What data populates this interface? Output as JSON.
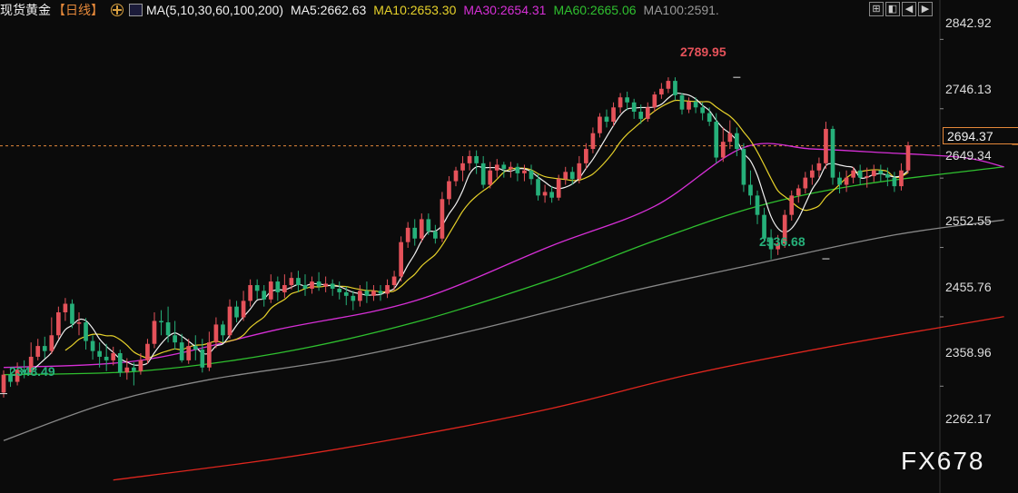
{
  "header": {
    "instrument": "现货黄金",
    "period": "【日线】",
    "study": "MA(5,10,30,60,100,200)",
    "ma5": "MA5:2662.63",
    "ma10": "MA10:2653.30",
    "ma30": "MA30:2654.31",
    "ma60": "MA60:2665.06",
    "ma100": "MA100:2591."
  },
  "toolbar": {
    "icons": [
      "fullscreen-icon",
      "layout-icon",
      "prev-icon",
      "next-icon"
    ]
  },
  "colors": {
    "up": "#e5525a",
    "down": "#26b07a",
    "ma5": "#f0f0f0",
    "ma10": "#e6d12a",
    "ma30": "#d62fd6",
    "ma60": "#2fc02f",
    "ma100": "#888888",
    "ma200": "#e0261e",
    "accent": "#e4883a"
  },
  "watermark": "FX678",
  "chart_data": {
    "type": "candlestick",
    "ylim": [
      2220,
      2870
    ],
    "y_ticks": [
      "2842.92",
      "2746.13",
      "2649.34",
      "2552.55",
      "2455.76",
      "2358.96",
      "2262.17"
    ],
    "y_tick_values": [
      2842.92,
      2746.13,
      2649.34,
      2552.55,
      2455.76,
      2358.96,
      2262.17
    ],
    "last_price": {
      "value": 2694.37,
      "label": "2694.37"
    },
    "annotations": [
      {
        "label": "2789.95",
        "value": 2789.95,
        "index": 107,
        "color": "#e5525a"
      },
      {
        "label": "2536.68",
        "value": 2536.68,
        "index": 120,
        "color": "#26b07a"
      },
      {
        "label": "2348.49",
        "value": 2348.49,
        "index": 0,
        "color": "#26b07a"
      }
    ],
    "candles": [
      [
        2350,
        2375,
        2343,
        2381
      ],
      [
        2375,
        2365,
        2358,
        2385
      ],
      [
        2365,
        2382,
        2360,
        2392
      ],
      [
        2382,
        2378,
        2370,
        2395
      ],
      [
        2378,
        2400,
        2375,
        2420
      ],
      [
        2400,
        2415,
        2395,
        2425
      ],
      [
        2415,
        2408,
        2398,
        2428
      ],
      [
        2408,
        2430,
        2404,
        2455
      ],
      [
        2430,
        2462,
        2425,
        2470
      ],
      [
        2462,
        2474,
        2450,
        2482
      ],
      [
        2474,
        2446,
        2440,
        2480
      ],
      [
        2446,
        2448,
        2430,
        2462
      ],
      [
        2448,
        2422,
        2410,
        2454
      ],
      [
        2422,
        2408,
        2396,
        2430
      ],
      [
        2408,
        2400,
        2385,
        2420
      ],
      [
        2400,
        2395,
        2380,
        2418
      ],
      [
        2395,
        2405,
        2388,
        2414
      ],
      [
        2405,
        2378,
        2372,
        2410
      ],
      [
        2378,
        2385,
        2368,
        2398
      ],
      [
        2385,
        2380,
        2360,
        2392
      ],
      [
        2380,
        2395,
        2375,
        2405
      ],
      [
        2395,
        2418,
        2390,
        2425
      ],
      [
        2418,
        2450,
        2412,
        2462
      ],
      [
        2450,
        2448,
        2430,
        2465
      ],
      [
        2448,
        2430,
        2420,
        2470
      ],
      [
        2430,
        2420,
        2410,
        2450
      ],
      [
        2420,
        2395,
        2392,
        2432
      ],
      [
        2395,
        2415,
        2390,
        2425
      ],
      [
        2415,
        2410,
        2395,
        2430
      ],
      [
        2410,
        2385,
        2378,
        2425
      ],
      [
        2385,
        2420,
        2380,
        2435
      ],
      [
        2420,
        2445,
        2412,
        2455
      ],
      [
        2445,
        2430,
        2420,
        2450
      ],
      [
        2430,
        2470,
        2425,
        2480
      ],
      [
        2470,
        2455,
        2448,
        2478
      ],
      [
        2455,
        2478,
        2450,
        2492
      ],
      [
        2478,
        2500,
        2470,
        2508
      ],
      [
        2500,
        2492,
        2480,
        2508
      ],
      [
        2492,
        2480,
        2470,
        2500
      ],
      [
        2480,
        2505,
        2475,
        2515
      ],
      [
        2505,
        2490,
        2478,
        2512
      ],
      [
        2490,
        2500,
        2482,
        2515
      ],
      [
        2500,
        2510,
        2494,
        2518
      ],
      [
        2510,
        2500,
        2490,
        2520
      ],
      [
        2500,
        2495,
        2485,
        2515
      ],
      [
        2495,
        2505,
        2488,
        2512
      ],
      [
        2505,
        2498,
        2492,
        2518
      ],
      [
        2498,
        2502,
        2490,
        2512
      ],
      [
        2502,
        2495,
        2485,
        2508
      ],
      [
        2495,
        2490,
        2480,
        2505
      ],
      [
        2490,
        2485,
        2472,
        2498
      ],
      [
        2485,
        2478,
        2465,
        2492
      ],
      [
        2478,
        2492,
        2470,
        2500
      ],
      [
        2492,
        2485,
        2475,
        2505
      ],
      [
        2485,
        2492,
        2478,
        2500
      ],
      [
        2492,
        2488,
        2478,
        2500
      ],
      [
        2488,
        2500,
        2482,
        2508
      ],
      [
        2500,
        2512,
        2492,
        2520
      ],
      [
        2512,
        2560,
        2505,
        2568
      ],
      [
        2560,
        2580,
        2552,
        2588
      ],
      [
        2580,
        2565,
        2555,
        2592
      ],
      [
        2565,
        2592,
        2560,
        2600
      ],
      [
        2592,
        2575,
        2570,
        2600
      ],
      [
        2575,
        2565,
        2558,
        2584
      ],
      [
        2565,
        2620,
        2560,
        2630
      ],
      [
        2620,
        2645,
        2612,
        2652
      ],
      [
        2645,
        2660,
        2638,
        2665
      ],
      [
        2660,
        2670,
        2645,
        2680
      ],
      [
        2670,
        2680,
        2660,
        2688
      ],
      [
        2680,
        2670,
        2655,
        2688
      ],
      [
        2670,
        2640,
        2635,
        2680
      ],
      [
        2640,
        2660,
        2635,
        2672
      ],
      [
        2660,
        2668,
        2650,
        2676
      ],
      [
        2668,
        2662,
        2650,
        2672
      ],
      [
        2662,
        2665,
        2650,
        2672
      ],
      [
        2665,
        2656,
        2645,
        2670
      ],
      [
        2656,
        2660,
        2645,
        2668
      ],
      [
        2660,
        2648,
        2640,
        2668
      ],
      [
        2648,
        2625,
        2618,
        2655
      ],
      [
        2625,
        2630,
        2615,
        2640
      ],
      [
        2630,
        2622,
        2615,
        2638
      ],
      [
        2622,
        2648,
        2618,
        2654
      ],
      [
        2648,
        2658,
        2640,
        2665
      ],
      [
        2658,
        2648,
        2640,
        2665
      ],
      [
        2648,
        2670,
        2642,
        2680
      ],
      [
        2670,
        2690,
        2662,
        2698
      ],
      [
        2690,
        2712,
        2684,
        2720
      ],
      [
        2712,
        2735,
        2706,
        2740
      ],
      [
        2735,
        2728,
        2720,
        2745
      ],
      [
        2728,
        2748,
        2722,
        2755
      ],
      [
        2748,
        2762,
        2740,
        2768
      ],
      [
        2762,
        2755,
        2744,
        2770
      ],
      [
        2755,
        2742,
        2732,
        2760
      ],
      [
        2742,
        2732,
        2725,
        2752
      ],
      [
        2732,
        2748,
        2728,
        2755
      ],
      [
        2748,
        2766,
        2742,
        2770
      ],
      [
        2766,
        2774,
        2760,
        2782
      ],
      [
        2774,
        2785,
        2768,
        2790
      ],
      [
        2785,
        2765,
        2758,
        2790
      ],
      [
        2765,
        2745,
        2738,
        2768
      ],
      [
        2745,
        2756,
        2740,
        2762
      ],
      [
        2756,
        2748,
        2740,
        2762
      ],
      [
        2748,
        2740,
        2730,
        2755
      ],
      [
        2740,
        2728,
        2722,
        2748
      ],
      [
        2728,
        2678,
        2670,
        2740
      ],
      [
        2678,
        2700,
        2672,
        2720
      ],
      [
        2700,
        2712,
        2690,
        2730
      ],
      [
        2712,
        2690,
        2680,
        2720
      ],
      [
        2690,
        2640,
        2630,
        2698
      ],
      [
        2640,
        2625,
        2612,
        2660
      ],
      [
        2625,
        2598,
        2585,
        2632
      ],
      [
        2598,
        2565,
        2560,
        2608
      ],
      [
        2565,
        2550,
        2536,
        2578
      ],
      [
        2550,
        2558,
        2542,
        2570
      ],
      [
        2558,
        2598,
        2552,
        2605
      ],
      [
        2598,
        2625,
        2590,
        2632
      ],
      [
        2625,
        2635,
        2615,
        2640
      ],
      [
        2635,
        2650,
        2628,
        2658
      ],
      [
        2650,
        2660,
        2640,
        2668
      ],
      [
        2660,
        2670,
        2650,
        2678
      ],
      [
        2670,
        2718,
        2662,
        2728
      ],
      [
        2718,
        2650,
        2640,
        2722
      ],
      [
        2650,
        2640,
        2628,
        2658
      ],
      [
        2640,
        2650,
        2630,
        2660
      ],
      [
        2650,
        2660,
        2642,
        2665
      ],
      [
        2660,
        2650,
        2640,
        2668
      ],
      [
        2650,
        2652,
        2636,
        2664
      ],
      [
        2652,
        2660,
        2644,
        2668
      ],
      [
        2660,
        2655,
        2645,
        2668
      ],
      [
        2655,
        2650,
        2638,
        2664
      ],
      [
        2650,
        2638,
        2630,
        2658
      ],
      [
        2638,
        2660,
        2632,
        2670
      ],
      [
        2660,
        2695,
        2656,
        2700
      ]
    ],
    "ma": {
      "ma30": {
        "name": "MA30",
        "color": "#d62fd6",
        "points": [
          [
            0,
            2385
          ],
          [
            20,
            2395
          ],
          [
            40,
            2438
          ],
          [
            60,
            2478
          ],
          [
            80,
            2555
          ],
          [
            95,
            2610
          ],
          [
            108,
            2692
          ],
          [
            118,
            2690
          ],
          [
            128,
            2685
          ],
          [
            140,
            2678
          ],
          [
            146,
            2665
          ]
        ]
      },
      "ma60": {
        "name": "MA60",
        "color": "#2fc02f",
        "points": [
          [
            0,
            2375
          ],
          [
            20,
            2380
          ],
          [
            40,
            2405
          ],
          [
            60,
            2448
          ],
          [
            80,
            2508
          ],
          [
            95,
            2562
          ],
          [
            110,
            2610
          ],
          [
            125,
            2640
          ],
          [
            146,
            2665
          ]
        ]
      },
      "ma100": {
        "name": "MA100",
        "color": "#888888",
        "points": [
          [
            0,
            2283
          ],
          [
            15,
            2335
          ],
          [
            30,
            2368
          ],
          [
            50,
            2398
          ],
          [
            70,
            2440
          ],
          [
            90,
            2488
          ],
          [
            110,
            2530
          ],
          [
            130,
            2570
          ],
          [
            146,
            2591
          ]
        ]
      },
      "ma200": {
        "name": "MA200",
        "color": "#e0261e",
        "points": [
          [
            16,
            2228
          ],
          [
            40,
            2258
          ],
          [
            60,
            2290
          ],
          [
            80,
            2328
          ],
          [
            100,
            2375
          ],
          [
            120,
            2413
          ],
          [
            146,
            2456
          ]
        ]
      }
    }
  }
}
